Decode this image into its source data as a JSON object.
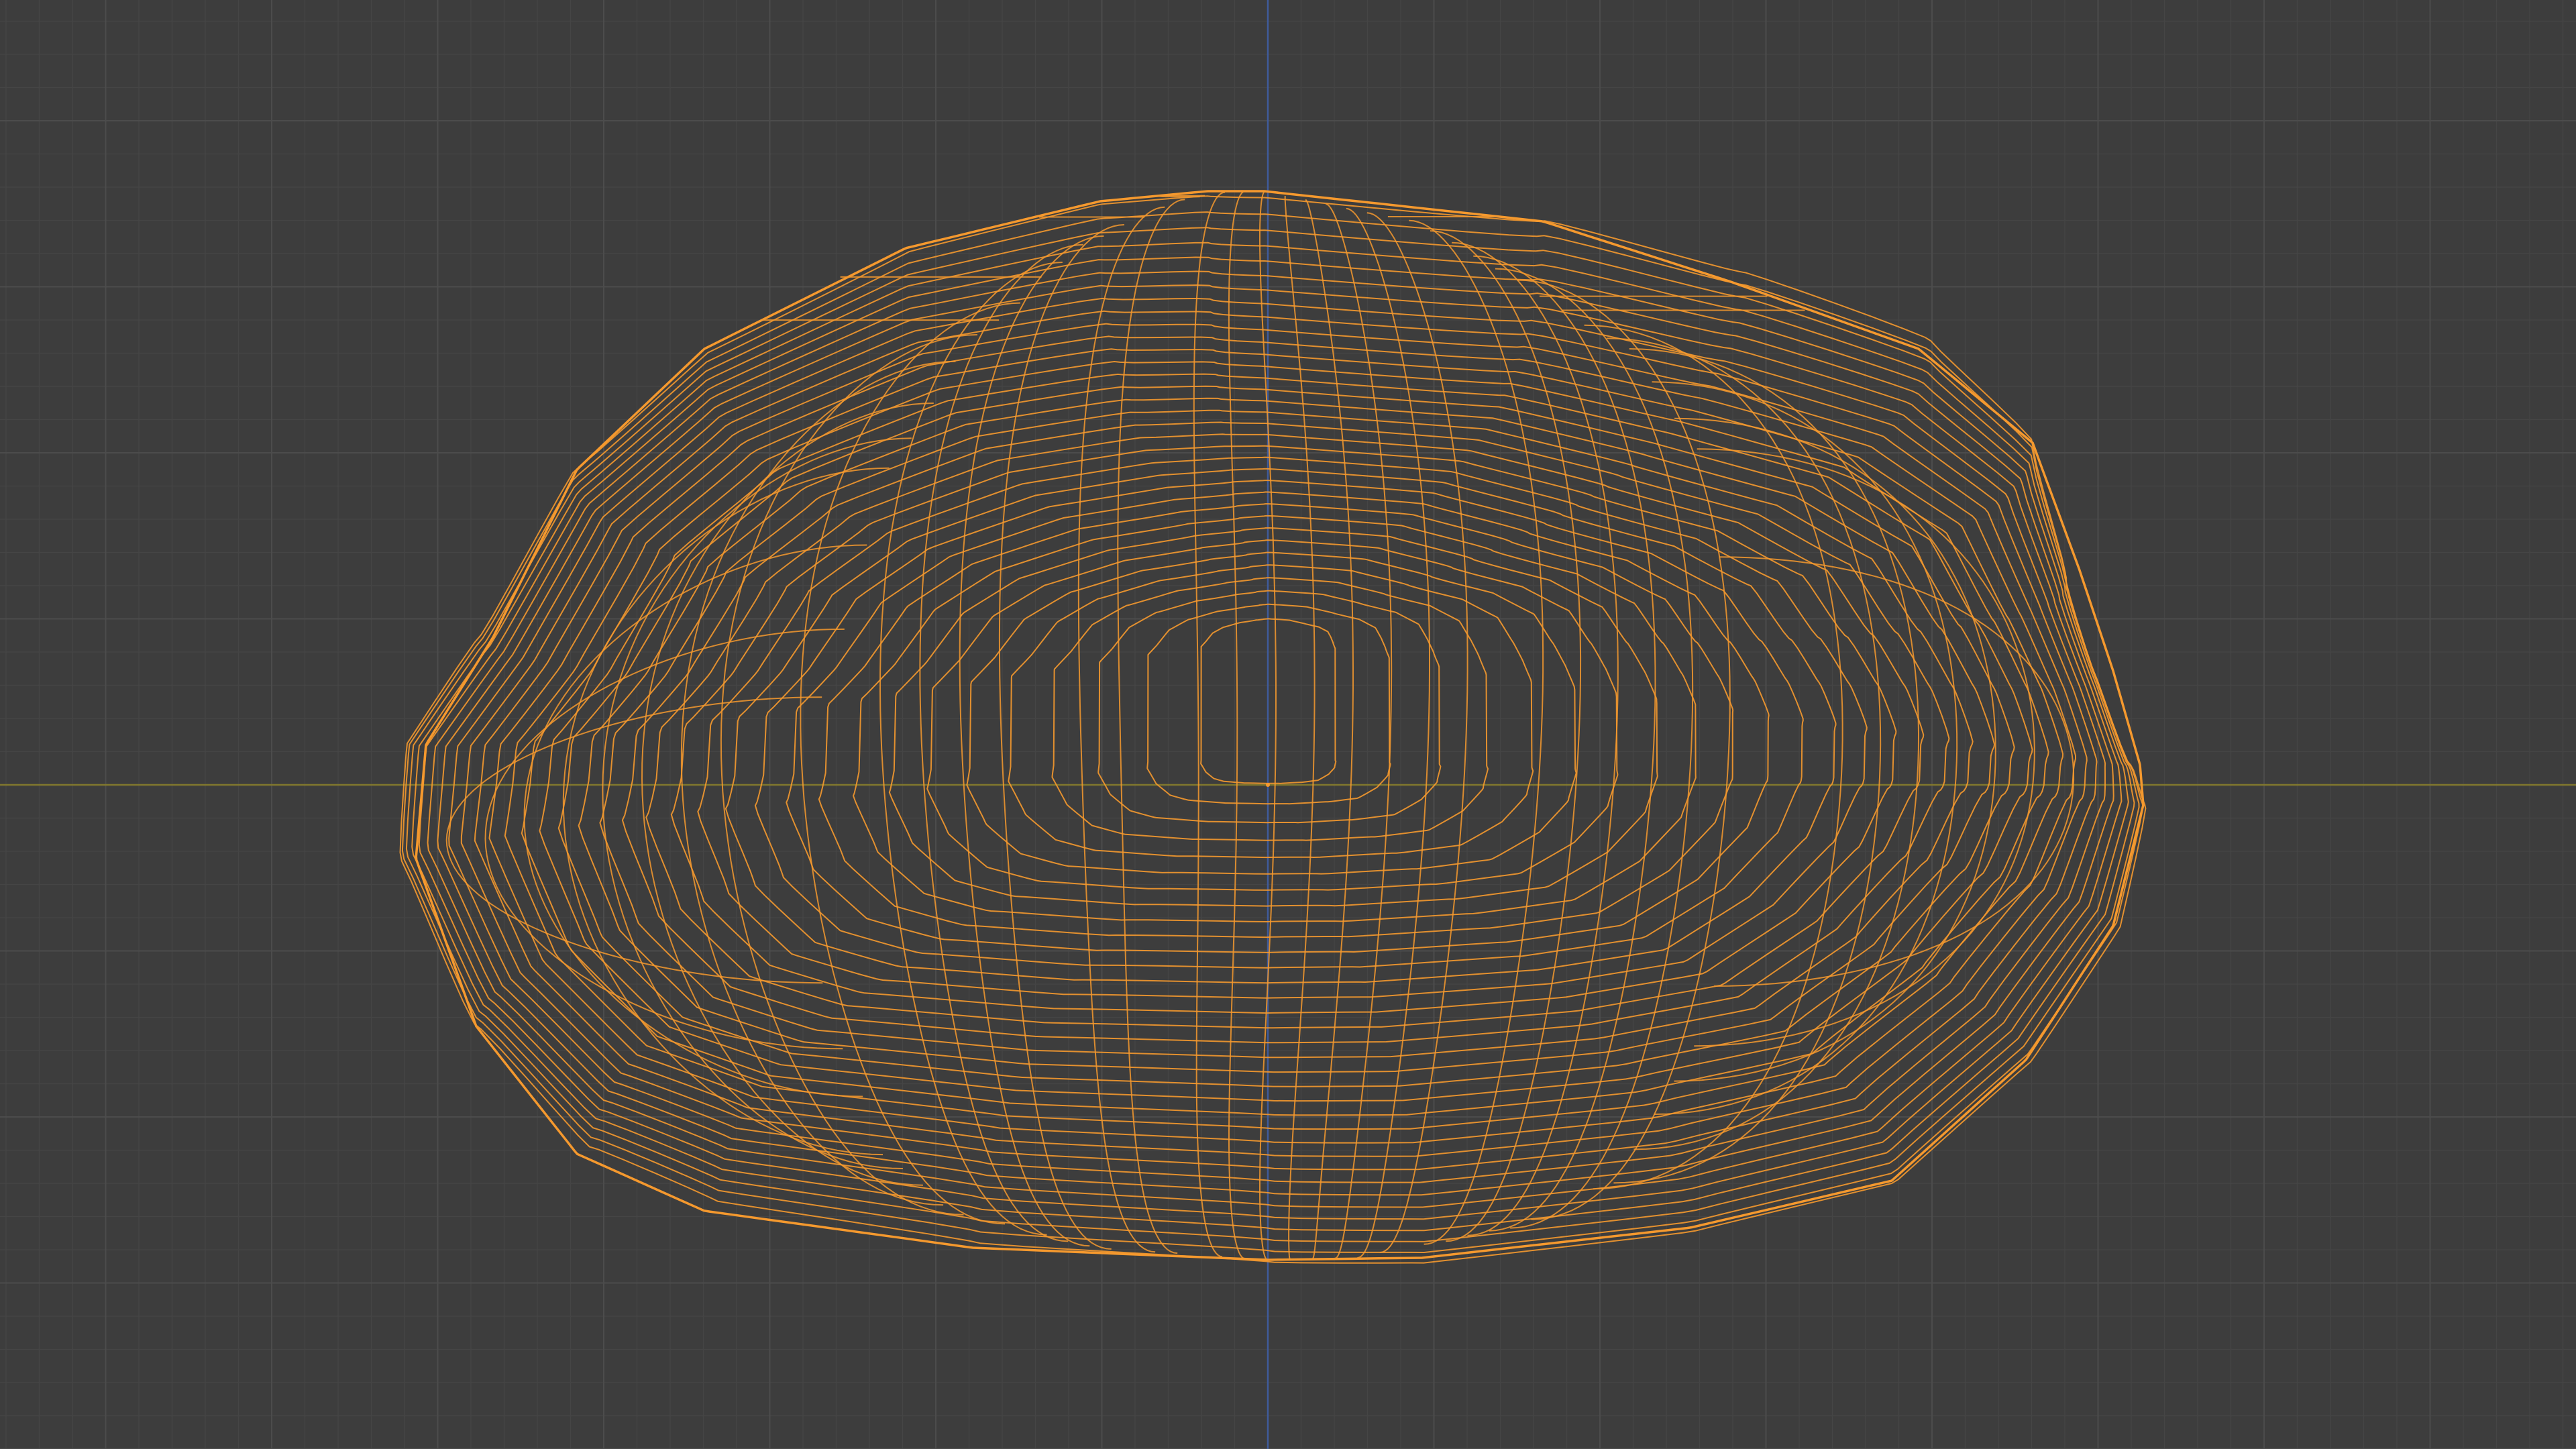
{
  "viewport": {
    "view": "orthographic-front",
    "background_color": "#3d3d3d",
    "grid": {
      "visible": true,
      "minor_color": "#454545",
      "major_color": "#4c4c4c"
    },
    "axes": {
      "x_axis_color": "#80772e",
      "z_axis_color": "#3f5b9a"
    },
    "object": {
      "display_mode": "wireframe",
      "selected": true,
      "wire_color": "#f5992e",
      "origin_color": "#f5992e"
    }
  }
}
